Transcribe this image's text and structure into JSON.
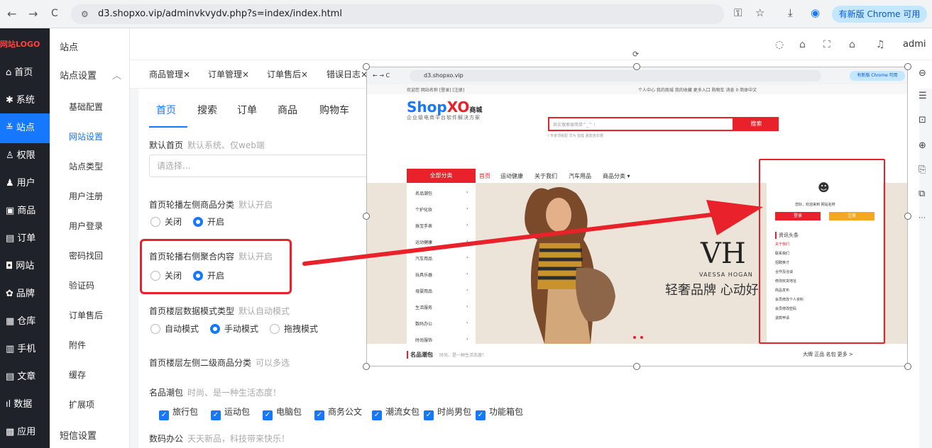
{
  "browser": {
    "back": "←",
    "forward": "→",
    "reload": "C",
    "url": "d3.shopxo.vip/adminvkvydv.php?s=index/index.html",
    "update_label": "有新版 Chrome 可用"
  },
  "sidebar": {
    "logo": "网站LOGO",
    "items": [
      {
        "label": "首页",
        "icon": "home-icon"
      },
      {
        "label": "系统",
        "icon": "gear-icon"
      },
      {
        "label": "站点",
        "icon": "sliders-icon"
      },
      {
        "label": "权限",
        "icon": "user-key-icon"
      },
      {
        "label": "用户",
        "icon": "user-icon"
      },
      {
        "label": "商品",
        "icon": "goods-icon"
      },
      {
        "label": "订单",
        "icon": "order-icon"
      },
      {
        "label": "网站",
        "icon": "web-icon"
      },
      {
        "label": "品牌",
        "icon": "brand-icon"
      },
      {
        "label": "仓库",
        "icon": "warehouse-icon"
      },
      {
        "label": "手机",
        "icon": "phone-icon"
      },
      {
        "label": "文章",
        "icon": "article-icon"
      },
      {
        "label": "数据",
        "icon": "chart-icon"
      },
      {
        "label": "应用",
        "icon": "apps-icon"
      }
    ]
  },
  "subsidebar": {
    "title": "站点",
    "group": "站点设置",
    "items": [
      "基础配置",
      "网站设置",
      "站点类型",
      "用户注册",
      "用户登录",
      "密码找回",
      "验证码",
      "订单售后",
      "附件",
      "缓存",
      "扩展项"
    ],
    "group2": "短信设置"
  },
  "header": {
    "user": "admi"
  },
  "tabs": [
    "商品管理×",
    "订单管理×",
    "订单售后×",
    "错误日志×"
  ],
  "content_tabs": [
    "首页",
    "搜索",
    "订单",
    "商品",
    "购物车"
  ],
  "form": {
    "default_home": {
      "label": "默认首页",
      "hint": "默认系统、仅web端",
      "placeholder": "请选择..."
    },
    "left_cat": {
      "label": "首页轮播左侧商品分类",
      "hint": "默认开启",
      "off": "关闭",
      "on": "开启"
    },
    "right_agg": {
      "label": "首页轮播右侧聚合内容",
      "hint": "默认开启",
      "off": "关闭",
      "on": "开启"
    },
    "floor_mode": {
      "label": "首页楼层数据模式类型",
      "hint": "默认自动模式",
      "opts": [
        "自动模式",
        "手动模式",
        "拖拽模式"
      ]
    },
    "floor_cat": {
      "label": "首页楼层左侧二级商品分类",
      "hint": "可以多选"
    },
    "cat1": {
      "title": "名品潮包",
      "hint": "时尚、是一种生活态度！",
      "items": [
        "旅行包",
        "运动包",
        "电脑包",
        "商务公文",
        "潮流女包",
        "时尚男包",
        "功能箱包"
      ]
    },
    "cat2": {
      "title": "数码办公",
      "hint": "天天新品，科技带来快乐！"
    }
  },
  "preview": {
    "url": "d3.shopxo.vip",
    "update": "有新版 Chrome 可用",
    "topbar_left": "欢迎您 网站名称 [登录] [注册]",
    "topbar_right": "个人中心  我的商城  我的收藏  更多入口  购物车  消息 0  简体中文",
    "logo_a": "Shop",
    "logo_b": "XO",
    "logo_c": "商城",
    "logo_sub": "企业级电商平台软件解决方案",
    "search_placeholder": "其实搜索很简单^_^ !",
    "search_btn": "搜索",
    "hot": "i 专家顶级配  华为  蓝蛙  夏款连衣裙",
    "allcat": "全部分类",
    "nav": [
      "首页",
      "运动健康",
      "关于我们",
      "汽车用品",
      "商品分类 ▾"
    ],
    "catmenu": [
      "名品潮包",
      "个护化妆",
      "珠宝手表",
      "运动健康",
      "汽车用品",
      "玩具乐器",
      "母婴用品",
      "生活服务",
      "数码办公",
      "时尚服饰"
    ],
    "brand": "VH",
    "brand_sub": "VAESSA HOGAN",
    "slogan": "轻奢品牌 心动好",
    "welcome": "您好，欢迎来到 网站名称",
    "login": "登录",
    "register": "注册",
    "news_title": "资讯头条",
    "news": [
      "关于我们",
      "联系我们",
      "招聘英才",
      "合作及洽谈",
      "修改收货地址",
      "商品发布",
      "会员修改个人资料",
      "会员修改密码",
      "退款申请"
    ],
    "section": "名品潮包",
    "section_hint": "时尚、是一种生活态度！",
    "section_right": "大牌  正品  名包  更多 >"
  }
}
